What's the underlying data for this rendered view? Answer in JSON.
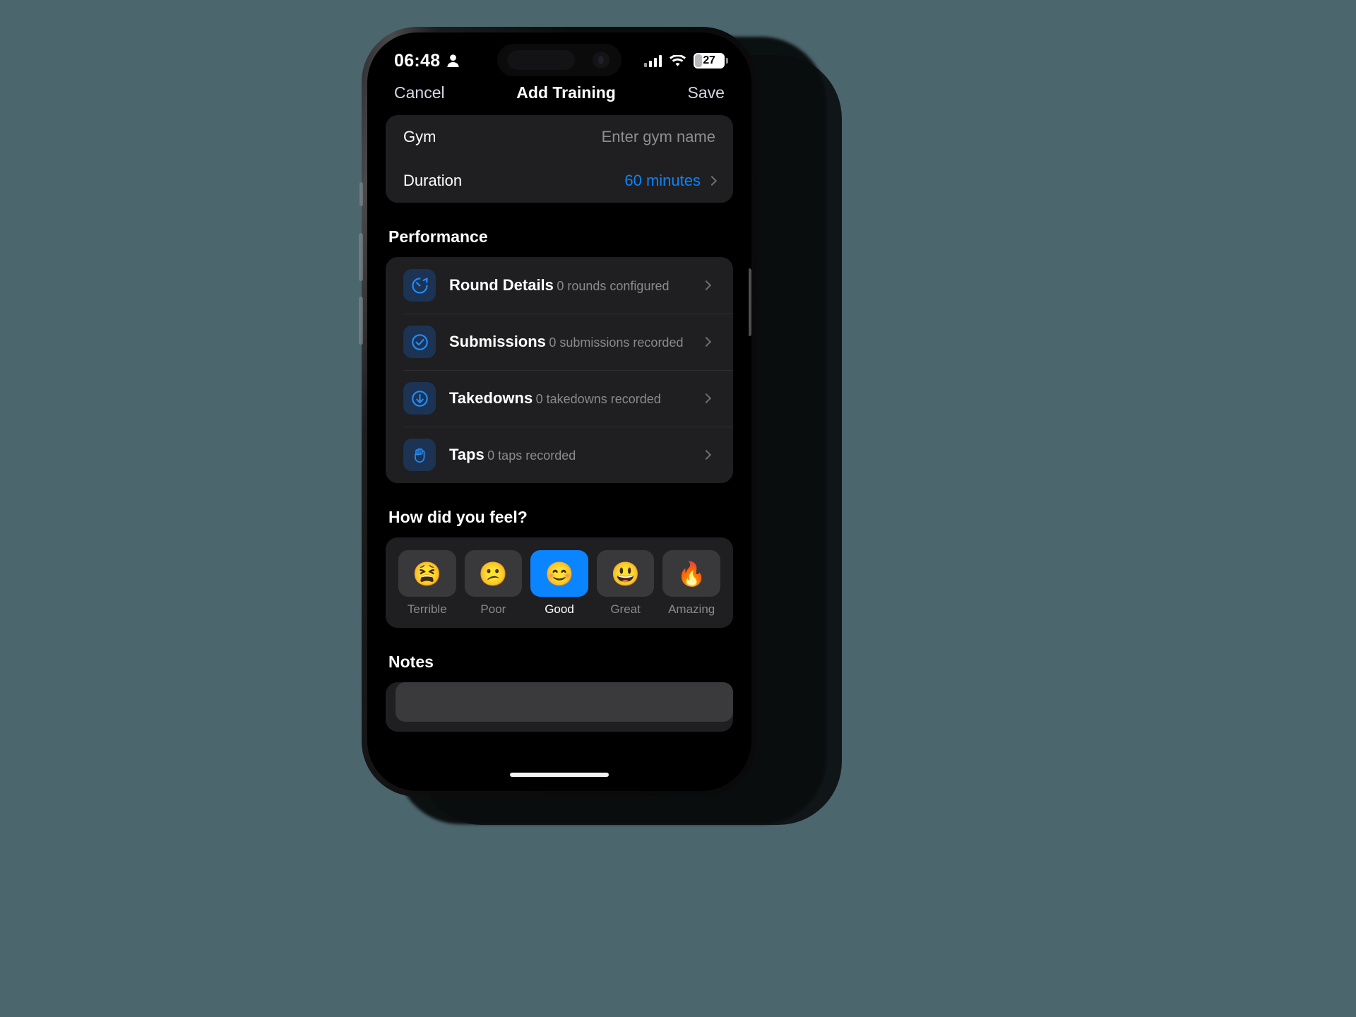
{
  "theme": {
    "page_background": "#4c666e",
    "screen_background": "#000000",
    "card_background": "#1f1f21",
    "accent_blue": "#0a84ff",
    "icon_tile_background": "#1c3354",
    "secondary_text": "#8a8a8f"
  },
  "status_bar": {
    "time": "06:48",
    "person_icon": "person-icon",
    "signal_icon": "cellular-signal-icon",
    "wifi_icon": "wifi-icon",
    "battery_level": "27",
    "battery_icon": "battery-icon"
  },
  "nav": {
    "cancel_label": "Cancel",
    "title": "Add Training",
    "save_label": "Save"
  },
  "details": {
    "gym": {
      "label": "Gym",
      "placeholder": "Enter gym name",
      "value": ""
    },
    "duration": {
      "label": "Duration",
      "value": "60 minutes",
      "chevron_icon": "chevron-right-icon"
    }
  },
  "performance": {
    "section_title": "Performance",
    "rows": [
      {
        "title": "Round Details",
        "subtitle": "0 rounds configured",
        "icon": "timer-icon",
        "chevron_icon": "chevron-right-icon"
      },
      {
        "title": "Submissions",
        "subtitle": "0 submissions recorded",
        "icon": "check-circle-icon",
        "chevron_icon": "chevron-right-icon"
      },
      {
        "title": "Takedowns",
        "subtitle": "0 takedowns recorded",
        "icon": "arrow-down-circle-icon",
        "chevron_icon": "chevron-right-icon"
      },
      {
        "title": "Taps",
        "subtitle": "0 taps recorded",
        "icon": "raised-hand-icon",
        "chevron_icon": "chevron-right-icon"
      }
    ]
  },
  "mood": {
    "section_title": "How did you feel?",
    "selected": "Good",
    "options": [
      {
        "label": "Terrible",
        "emoji": "😫"
      },
      {
        "label": "Poor",
        "emoji": "😕"
      },
      {
        "label": "Good",
        "emoji": "😊"
      },
      {
        "label": "Great",
        "emoji": "😃"
      },
      {
        "label": "Amazing",
        "emoji": "🔥"
      }
    ]
  },
  "notes": {
    "section_title": "Notes",
    "value": ""
  }
}
